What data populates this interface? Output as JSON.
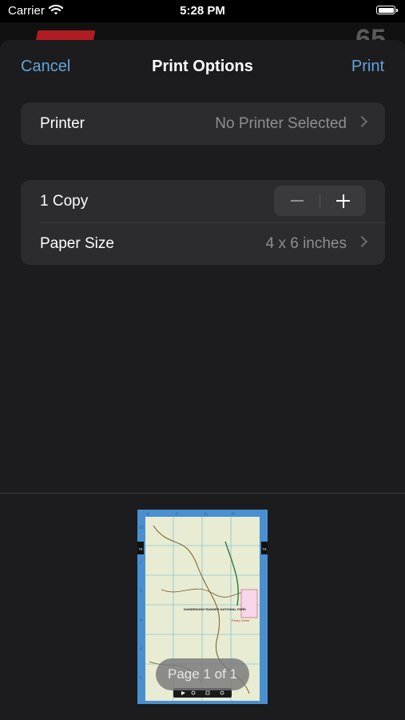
{
  "status_bar": {
    "carrier": "Carrier",
    "time": "5:28 PM"
  },
  "background_app": {
    "number": "65"
  },
  "nav": {
    "cancel_label": "Cancel",
    "title": "Print Options",
    "print_label": "Print"
  },
  "printer_row": {
    "label": "Printer",
    "value": "No Printer Selected"
  },
  "copies_row": {
    "label": "1 Copy",
    "count": 1
  },
  "paper_row": {
    "label": "Paper Size",
    "value": "4 x 6 inches"
  },
  "preview": {
    "page_indicator": "Page 1 of 1",
    "map_column_labels": [
      "E",
      "F",
      "G",
      "H"
    ],
    "map_row_labels": [
      "1/2",
      "2",
      "3",
      "4",
      "5",
      "6"
    ],
    "map_page_tabs": [
      "74",
      "74"
    ],
    "map_labels": [
      "DANDENONG RANGES NATIONAL PARK",
      "Ferny Creek"
    ]
  },
  "colors": {
    "accent": "#64a3d9",
    "sheet_bg": "#1c1c1e",
    "group_bg": "#2c2c2e",
    "secondary_text": "#8e8e93"
  }
}
